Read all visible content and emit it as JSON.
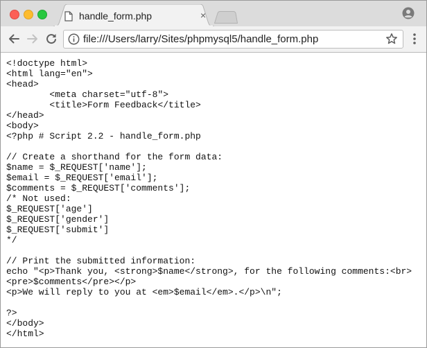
{
  "tab": {
    "title": "handle_form.php",
    "close_glyph": "×"
  },
  "toolbar": {
    "url": "file:///Users/larry/Sites/phpmysql5/handle_form.php"
  },
  "icons": {
    "tab": "page-icon",
    "back": "back-arrow-icon",
    "forward": "forward-arrow-icon",
    "reload": "reload-icon",
    "info": "info-icon",
    "bookmark": "star-icon",
    "menu": "menu-dots-icon",
    "profile": "profile-icon"
  },
  "colors": {
    "close": "#fc5f57",
    "minimize": "#fdbc2e",
    "maximize": "#28c840"
  },
  "content": {
    "source": "<!doctype html>\n<html lang=\"en\">\n<head>\n\t<meta charset=\"utf-8\">\n\t<title>Form Feedback</title>\n</head>\n<body>\n<?php # Script 2.2 - handle_form.php\n\n// Create a shorthand for the form data:\n$name = $_REQUEST['name'];\n$email = $_REQUEST['email'];\n$comments = $_REQUEST['comments'];\n/* Not used:\n$_REQUEST['age']\n$_REQUEST['gender']\n$_REQUEST['submit']\n*/\n\n// Print the submitted information:\necho \"<p>Thank you, <strong>$name</strong>, for the following comments:<br>\n<pre>$comments</pre></p>\n<p>We will reply to you at <em>$email</em>.</p>\\n\";\n\n?>\n</body>\n</html>"
  }
}
